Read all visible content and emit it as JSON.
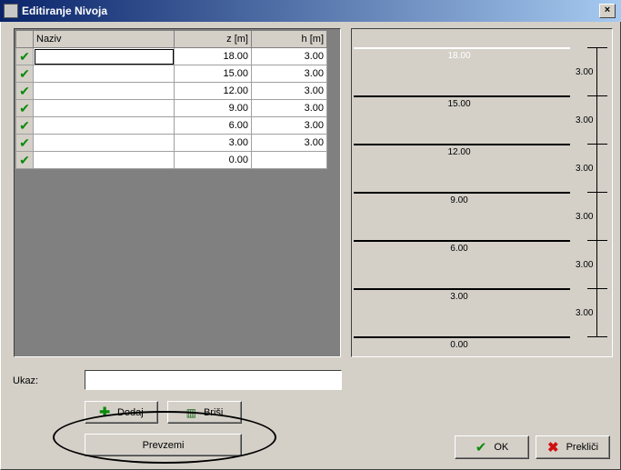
{
  "window": {
    "title": "Editiranje Nivoja",
    "close_glyph": "×"
  },
  "grid": {
    "headers": {
      "naziv": "Naziv",
      "z": "z [m]",
      "h": "h [m]"
    },
    "rows": [
      {
        "naziv": "",
        "z": "18.00",
        "h": "3.00"
      },
      {
        "naziv": "",
        "z": "15.00",
        "h": "3.00"
      },
      {
        "naziv": "",
        "z": "12.00",
        "h": "3.00"
      },
      {
        "naziv": "",
        "z": "9.00",
        "h": "3.00"
      },
      {
        "naziv": "",
        "z": "6.00",
        "h": "3.00"
      },
      {
        "naziv": "",
        "z": "3.00",
        "h": "3.00"
      },
      {
        "naziv": "",
        "z": "0.00",
        "h": ""
      }
    ]
  },
  "preview": {
    "levels": [
      "18.00",
      "15.00",
      "12.00",
      "9.00",
      "6.00",
      "3.00",
      "0.00"
    ],
    "heights": [
      "3.00",
      "3.00",
      "3.00",
      "3.00",
      "3.00",
      "3.00"
    ]
  },
  "ukaz": {
    "label": "Ukaz:",
    "value": ""
  },
  "buttons": {
    "dodaj": "Dodaj",
    "brisi": "Briši",
    "prevzemi": "Prevzemi",
    "ok": "OK",
    "preklici": "Prekliči"
  },
  "icons": {
    "row_check": "check-icon",
    "dodaj": "plus-icon",
    "brisi": "trash-icon",
    "ok": "check-icon",
    "preklici": "x-icon"
  }
}
